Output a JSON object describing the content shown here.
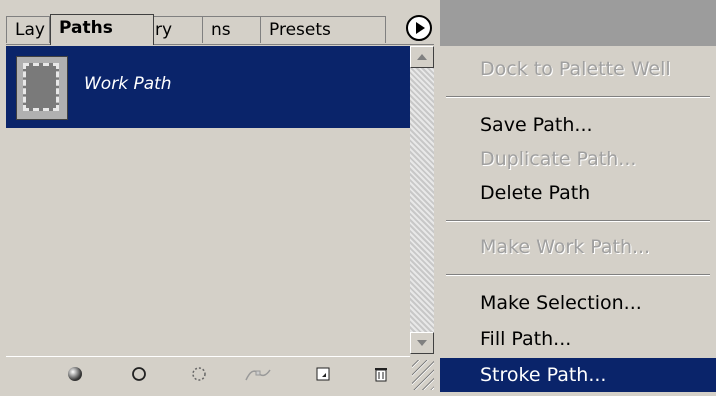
{
  "panel": {
    "tabs": [
      "Lay",
      "Paths",
      "ry",
      "ns",
      "Presets"
    ],
    "active_tab": "Paths",
    "path_row": {
      "label": "Work Path"
    }
  },
  "bottom_icons": [
    "fill-path-icon",
    "stroke-path-icon",
    "load-selection-icon",
    "make-work-path-icon",
    "new-path-icon",
    "trash-icon"
  ],
  "menu": {
    "items": [
      {
        "label": "Dock to Palette Well",
        "state": "disabled"
      },
      {
        "label": "Save Path...",
        "state": "enabled"
      },
      {
        "label": "Duplicate Path...",
        "state": "disabled"
      },
      {
        "label": "Delete Path",
        "state": "enabled"
      },
      {
        "label": "Make Work Path...",
        "state": "disabled"
      },
      {
        "label": "Make Selection...",
        "state": "enabled"
      },
      {
        "label": "Fill Path...",
        "state": "enabled"
      },
      {
        "label": "Stroke Path...",
        "state": "selected"
      }
    ]
  },
  "colors": {
    "selection": "#0a246a",
    "panel_bg": "#d4d0c8",
    "disabled_text": "#a0a0a0"
  }
}
